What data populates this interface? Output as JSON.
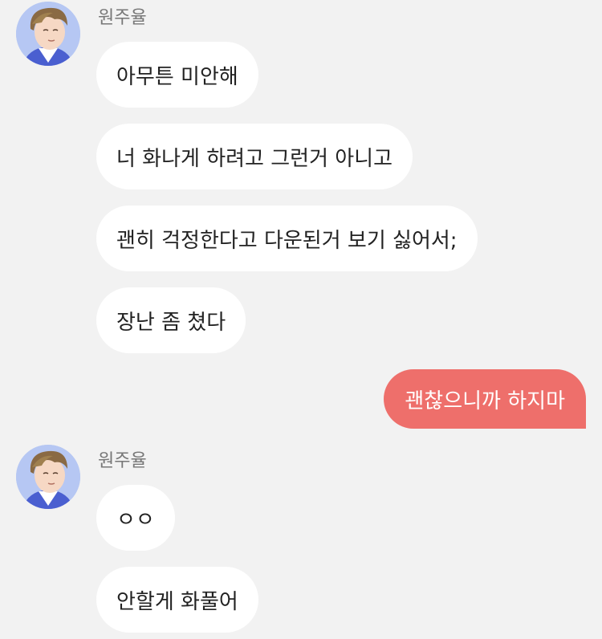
{
  "conversation": {
    "groups": [
      {
        "sender": "원주율",
        "messages": [
          "아무튼 미안해",
          "너 화나게 하려고 그런거 아니고",
          "괜히 걱정한다고 다운된거 보기 싫어서;",
          "장난 좀 쳤다"
        ]
      },
      {
        "sender": "원주율",
        "messages": [
          "ㅇㅇ",
          "안할게 화풀어"
        ]
      }
    ],
    "outgoing": [
      "괜찮으니까 하지마"
    ]
  },
  "colors": {
    "background": "#f2f2f2",
    "incoming_bubble": "#ffffff",
    "outgoing_bubble": "#ee6f6b",
    "sender_name": "#777777"
  },
  "icons": {
    "avatar": "person-avatar-icon"
  }
}
